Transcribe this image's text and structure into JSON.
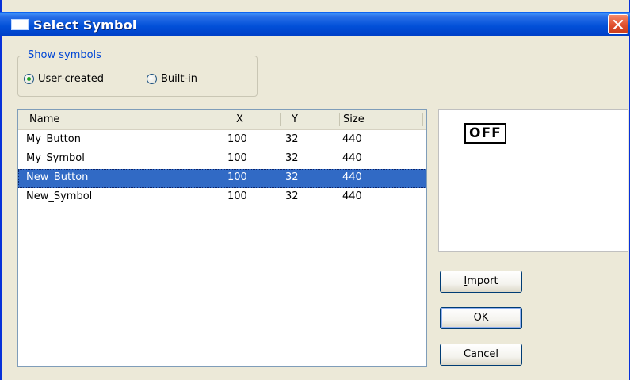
{
  "window": {
    "title": "Select Symbol",
    "close_glyph": "close-icon"
  },
  "show_symbols": {
    "legend_mnemonic": "S",
    "legend_rest": "how symbols",
    "options": [
      {
        "label": "User-created",
        "selected": true
      },
      {
        "label": "Built-in",
        "selected": false
      }
    ]
  },
  "table": {
    "columns": [
      "Name",
      "X",
      "Y",
      "Size"
    ],
    "rows": [
      {
        "name": "My_Button",
        "x": "100",
        "y": "32",
        "size": "440",
        "selected": false
      },
      {
        "name": "My_Symbol",
        "x": "100",
        "y": "32",
        "size": "440",
        "selected": false
      },
      {
        "name": "New_Button",
        "x": "100",
        "y": "32",
        "size": "440",
        "selected": true
      },
      {
        "name": "New_Symbol",
        "x": "100",
        "y": "32",
        "size": "440",
        "selected": false
      }
    ]
  },
  "preview": {
    "text": "OFF"
  },
  "buttons": {
    "import_mnemonic": "I",
    "import_rest": "mport",
    "ok": "OK",
    "cancel": "Cancel"
  },
  "colors": {
    "title_bar": "#0250d8",
    "dialog_bg": "#ece9d8",
    "selection": "#316ac5",
    "close_button": "#e0502d"
  }
}
